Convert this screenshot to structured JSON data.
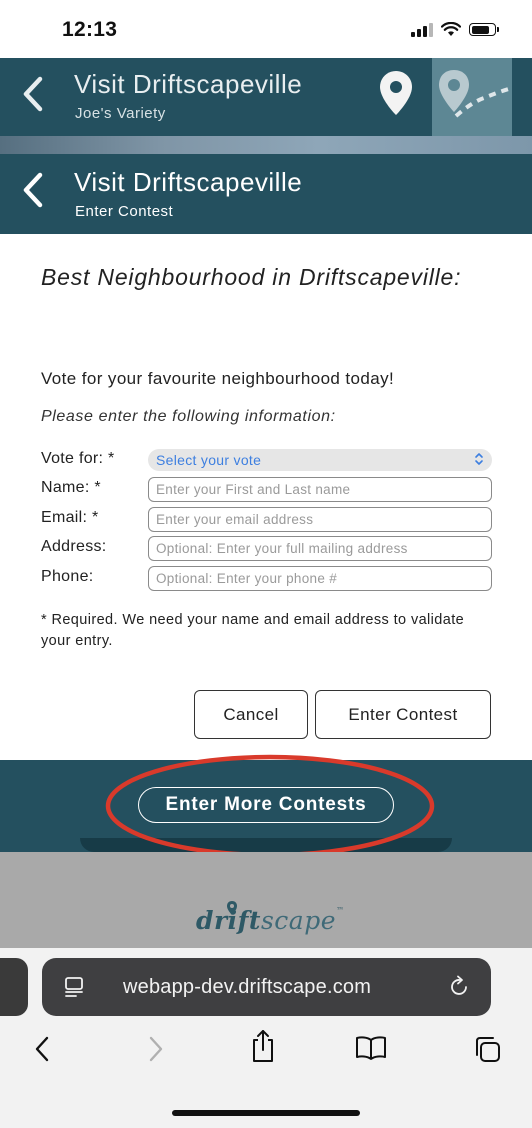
{
  "status_bar": {
    "time": "12:13",
    "battery_level": 0.8
  },
  "header_previous": {
    "title": "Visit Driftscapeville",
    "subtitle": "Joe's Variety"
  },
  "header": {
    "title": "Visit Driftscapeville",
    "subtitle": "Enter Contest"
  },
  "contest": {
    "heading": "Best Neighbourhood in Driftscapeville:",
    "intro": "Vote for your favourite neighbourhood today!",
    "instructions": "Please enter the following information:"
  },
  "form": {
    "vote_label": "Vote for: *",
    "vote_selected": "Select your vote",
    "name_label": "Name: *",
    "name_placeholder": "Enter your First and Last name",
    "email_label": "Email: *",
    "email_placeholder": "Enter your email address",
    "address_label": "Address:",
    "address_placeholder": "Optional: Enter your full mailing address",
    "phone_label": "Phone:",
    "phone_placeholder": "Optional: Enter your phone #",
    "required_note": "* Required. We need your name and email address to validate your entry."
  },
  "buttons": {
    "cancel": "Cancel",
    "enter_contest": "Enter Contest",
    "enter_more": "Enter More Contests"
  },
  "logo": {
    "part1": "drift",
    "part2": "scape",
    "tm": "™"
  },
  "browser": {
    "url": "webapp-dev.driftscape.com"
  },
  "colors": {
    "brand_teal": "#24505f",
    "annotation_red": "#d93a2b",
    "select_blue": "#3d7fe0"
  }
}
